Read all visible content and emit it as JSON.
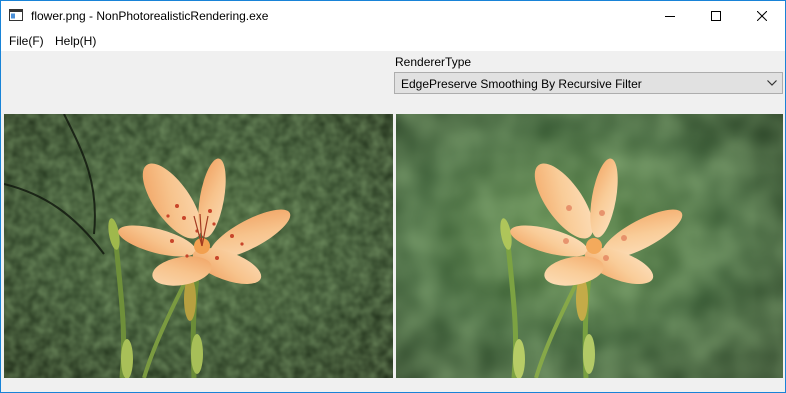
{
  "window": {
    "title": "flower.png - NonPhotorealisticRendering.exe",
    "icon": "app-window-icon",
    "controls": [
      "minimize-icon",
      "maximize-icon",
      "close-icon"
    ]
  },
  "menu": {
    "items": [
      {
        "label": "File(F)"
      },
      {
        "label": "Help(H)"
      }
    ]
  },
  "renderer": {
    "label": "RendererType",
    "selected": "EdgePreserve Smoothing By Recursive Filter"
  },
  "images": {
    "original": "photo of an orange speckled lily flower against dark green foliage",
    "rendered": "smoothed, painterly version of the same lily photo"
  },
  "colors": {
    "accent": "#1883d7",
    "background": "#f0f0f0",
    "petal": "#f6b074",
    "foliage": "#2f4d2a"
  }
}
